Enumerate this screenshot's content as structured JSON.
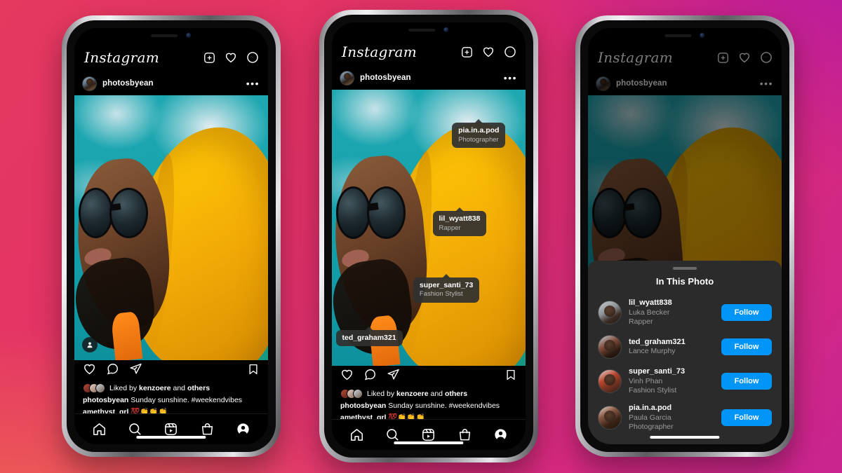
{
  "background": {
    "colors": [
      "#E5395F",
      "#F0684F",
      "#B117A8",
      "#C92490"
    ]
  },
  "app": {
    "logo": "Instagram",
    "header_icons": [
      "add-post-icon",
      "heart-icon",
      "messenger-icon"
    ],
    "post": {
      "username": "photosbyean",
      "more_label": "•••",
      "actions": [
        "heart-icon",
        "comment-icon",
        "share-icon",
        "bookmark-icon"
      ],
      "likes_prefix": "Liked by",
      "likes_user": "kenzoere",
      "likes_suffix": "and",
      "likes_others": "others",
      "caption_user": "photosbyean",
      "caption_text": "Sunday sunshine. #weekendvibes",
      "comment_user": "amethyst_grl",
      "comment_emoji": "💯👏👏👏"
    },
    "tabbar": [
      "home-icon",
      "search-icon",
      "reels-icon",
      "shop-icon",
      "profile-icon"
    ]
  },
  "phone1": {
    "tag_badge": "person-tag-badge-icon"
  },
  "phone2": {
    "nametags": [
      {
        "user": "pia.in.a.pod",
        "role": "Photographer"
      },
      {
        "user": "lil_wyatt838",
        "role": "Rapper"
      },
      {
        "user": "super_santi_73",
        "role": "Fashion Stylist"
      },
      {
        "user": "ted_graham321",
        "role": ""
      }
    ]
  },
  "phone3": {
    "sheet": {
      "title": "In This Photo",
      "follow_label": "Follow",
      "people": [
        {
          "username": "lil_wyatt838",
          "name": "Luka Becker",
          "role": "Rapper"
        },
        {
          "username": "ted_graham321",
          "name": "Lance Murphy",
          "role": ""
        },
        {
          "username": "super_santi_73",
          "name": "Vinh Phan",
          "role": "Fashion Stylist"
        },
        {
          "username": "pia.in.a.pod",
          "name": "Paula Garcia",
          "role": "Photographer"
        }
      ]
    }
  }
}
